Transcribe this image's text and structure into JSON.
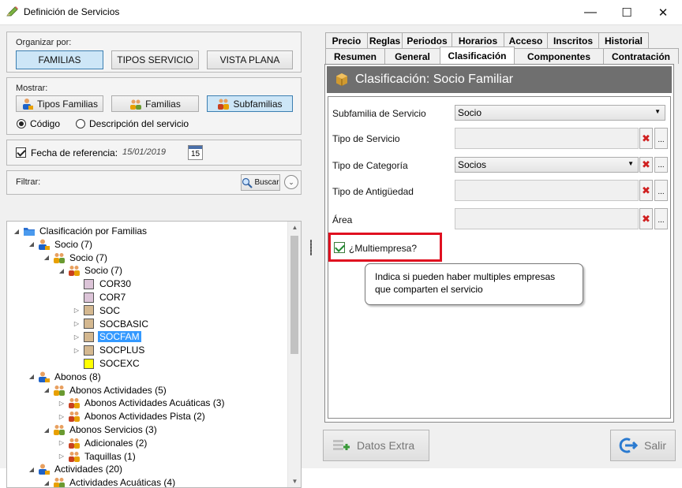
{
  "window": {
    "title": "Definición de Servicios",
    "minimize": "—",
    "maximize": "☐",
    "close": "✕"
  },
  "organize": {
    "label": "Organizar por:",
    "buttons": [
      "FAMILIAS",
      "TIPOS SERVICIO",
      "VISTA PLANA"
    ],
    "active": "FAMILIAS"
  },
  "show": {
    "label": "Mostrar:",
    "buttons": [
      "Tipos Familias",
      "Familias",
      "Subfamilias"
    ],
    "active": "Subfamilias",
    "radio_code": "Código",
    "radio_desc": "Descripción del servicio"
  },
  "refdate": {
    "label": "Fecha de referencia:",
    "value": "15/01/2019",
    "cal_day": "15"
  },
  "filter": {
    "label": "Filtrar:",
    "search_label": "Buscar"
  },
  "tree": [
    {
      "label": "Clasificación por Familias",
      "level": 0,
      "toggle": "◢",
      "icon": "folder"
    },
    {
      "label": "Socio (7)",
      "level": 1,
      "toggle": "◢",
      "icon": "person"
    },
    {
      "label": "Socio (7)",
      "level": 2,
      "toggle": "◢",
      "icon": "people"
    },
    {
      "label": "Socio (7)",
      "level": 3,
      "toggle": "◢",
      "icon": "group"
    },
    {
      "label": "COR30",
      "level": 4,
      "toggle": "",
      "swatch": "#dcc4d8"
    },
    {
      "label": "COR7",
      "level": 4,
      "toggle": "",
      "swatch": "#dcc4d8"
    },
    {
      "label": "SOC",
      "level": 4,
      "toggle": "▷",
      "swatch": "#d4b890"
    },
    {
      "label": "SOCBASIC",
      "level": 4,
      "toggle": "▷",
      "swatch": "#d4b890"
    },
    {
      "label": "SOCFAM",
      "level": 4,
      "toggle": "▷",
      "swatch": "#d4b890",
      "selected": true
    },
    {
      "label": "SOCPLUS",
      "level": 4,
      "toggle": "▷",
      "swatch": "#d4b890"
    },
    {
      "label": "SOCEXC",
      "level": 4,
      "toggle": "",
      "swatch": "#ffff00"
    },
    {
      "label": "Abonos (8)",
      "level": 1,
      "toggle": "◢",
      "icon": "person"
    },
    {
      "label": "Abonos Actividades (5)",
      "level": 2,
      "toggle": "◢",
      "icon": "people"
    },
    {
      "label": "Abonos Actividades Acuáticas (3)",
      "level": 3,
      "toggle": "▷",
      "icon": "group"
    },
    {
      "label": "Abonos Actividades Pista (2)",
      "level": 3,
      "toggle": "▷",
      "icon": "group"
    },
    {
      "label": "Abonos Servicios (3)",
      "level": 2,
      "toggle": "◢",
      "icon": "people"
    },
    {
      "label": "Adicionales (2)",
      "level": 3,
      "toggle": "▷",
      "icon": "group"
    },
    {
      "label": "Taquillas (1)",
      "level": 3,
      "toggle": "▷",
      "icon": "group"
    },
    {
      "label": "Actividades (20)",
      "level": 1,
      "toggle": "◢",
      "icon": "person"
    },
    {
      "label": "Actividades Acuáticas (4)",
      "level": 2,
      "toggle": "◢",
      "icon": "people"
    }
  ],
  "tabs_row1": [
    "Precio",
    "Reglas",
    "Periodos",
    "Horarios",
    "Acceso",
    "Inscritos",
    "Historial"
  ],
  "tabs_row2": [
    "Resumen",
    "General",
    "Clasificación",
    "Componentes",
    "Contratación"
  ],
  "selected_tab": "Clasificación",
  "panel": {
    "header": "Clasificación: Socio Familiar",
    "fields": {
      "subfamilia_label": "Subfamilia de Servicio",
      "subfamilia_value": "Socio",
      "tipo_servicio_label": "Tipo de Servicio",
      "tipo_categoria_label": "Tipo de Categoría",
      "tipo_categoria_value": "Socios",
      "antiguedad_label": "Tipo de Antigüedad",
      "area_label": "Área",
      "clear_glyph": "✖",
      "browse_glyph": "..."
    },
    "multiempresa_label": "¿Multiempresa?",
    "multiempresa_checked": true,
    "tooltip": "Indica si pueden haber multiples empresas que comparten el servicio"
  },
  "footer": {
    "extra_label": "Datos Extra",
    "exit_label": "Salir"
  },
  "colors": {
    "accent_active": "#cde6f7",
    "header_bg": "#6f6f6f",
    "highlight_box": "#e01020",
    "selection": "#3399ff"
  }
}
